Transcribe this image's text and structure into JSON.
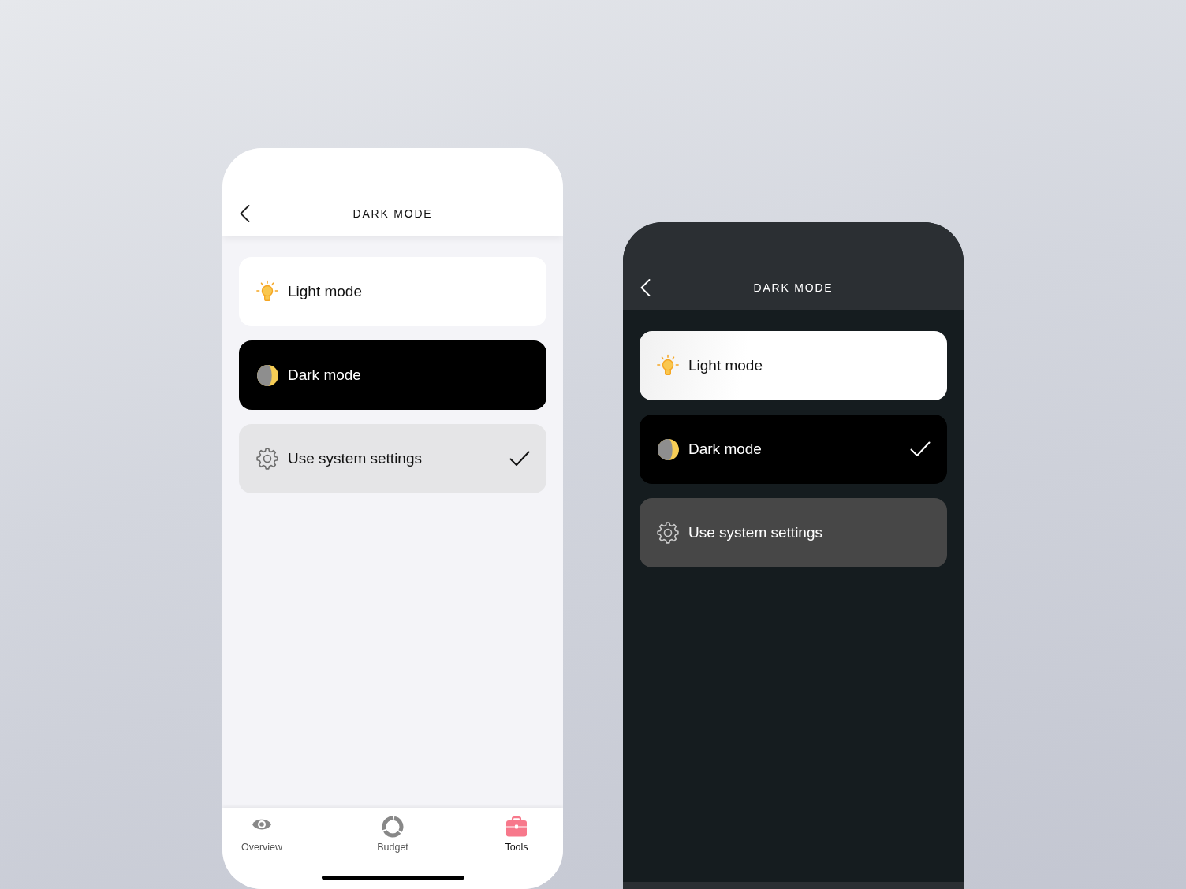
{
  "screens": [
    {
      "kind": "light",
      "title": "DARK MODE",
      "options": [
        {
          "kind": "light",
          "label": "Light mode",
          "selected": false
        },
        {
          "kind": "dark",
          "label": "Dark mode",
          "selected": false
        },
        {
          "kind": "system",
          "label": "Use system settings",
          "selected": true
        }
      ],
      "tab_bar": {
        "tabs": [
          {
            "kind": "eye",
            "label": "Overview",
            "selected": false
          },
          {
            "kind": "ring",
            "label": "Budget",
            "selected": false
          },
          {
            "kind": "toolbox",
            "label": "Tools",
            "selected": true
          }
        ]
      }
    },
    {
      "kind": "dark",
      "title": "DARK MODE",
      "options": [
        {
          "kind": "light",
          "label": "Light mode",
          "selected": false
        },
        {
          "kind": "dark",
          "label": "Dark mode",
          "selected": true
        },
        {
          "kind": "system",
          "label": "Use system settings",
          "selected": false
        }
      ]
    }
  ]
}
